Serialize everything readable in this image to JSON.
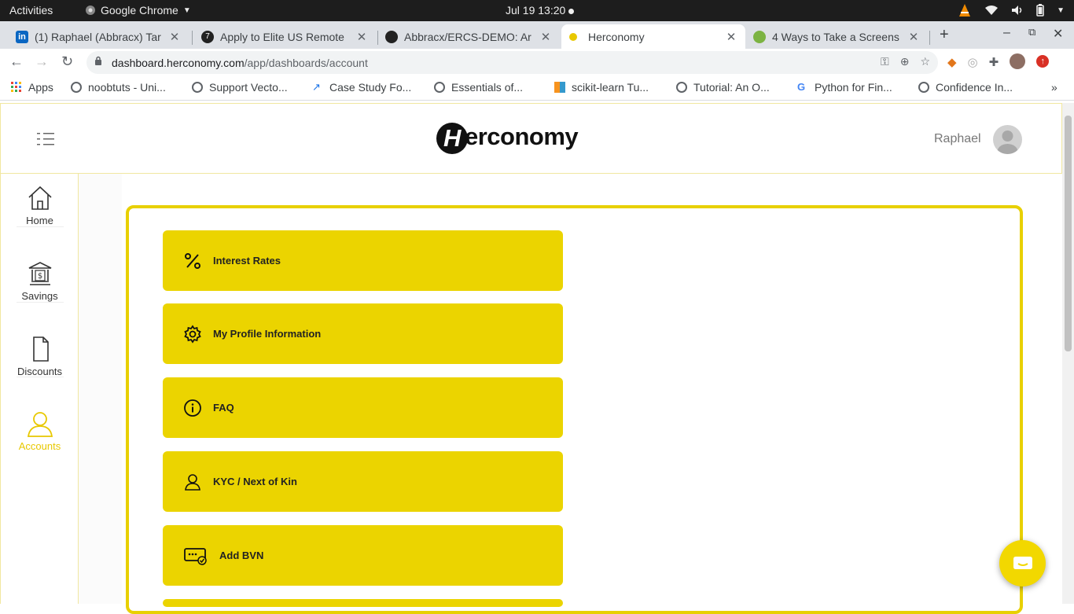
{
  "system_bar": {
    "activities": "Activities",
    "app_name": "Google Chrome",
    "clock": "Jul 19  13:20"
  },
  "tabs": [
    {
      "title": "(1) Raphael (Abbracx) Tar",
      "icon": "linkedin-icon",
      "color": "#0a66c2"
    },
    {
      "title": "Apply to Elite US Remote",
      "icon": "turing-icon",
      "color": "#222222"
    },
    {
      "title": "Abbracx/ERCS-DEMO: Ar",
      "icon": "github-icon",
      "color": "#222222"
    },
    {
      "title": "Herconomy",
      "icon": "herconomy-icon",
      "color": "#e8c800"
    },
    {
      "title": "4 Ways to Take a Screens",
      "icon": "wikihow-icon",
      "color": "#7cb342"
    }
  ],
  "address_bar": {
    "domain": "dashboard.herconomy.com",
    "path": "/app/dashboards/account"
  },
  "bookmarks": [
    {
      "label": "Apps",
      "icon": "apps-grid-icon"
    },
    {
      "label": "noobtuts - Uni...",
      "icon": "globe-icon"
    },
    {
      "label": "Support Vecto...",
      "icon": "globe-icon"
    },
    {
      "label": "Case Study Fo...",
      "icon": "chart-icon"
    },
    {
      "label": "Essentials of...",
      "icon": "globe-icon"
    },
    {
      "label": "scikit-learn Tu...",
      "icon": "bar-icon"
    },
    {
      "label": "Tutorial: An O...",
      "icon": "globe-icon"
    },
    {
      "label": "Python for Fin...",
      "icon": "google-icon"
    },
    {
      "label": "Confidence In...",
      "icon": "globe-icon"
    }
  ],
  "header": {
    "logo_text": "erconomy",
    "logo_mark": "H",
    "username": "Raphael"
  },
  "sidebar": {
    "items": [
      {
        "label": "Home",
        "icon": "home-icon"
      },
      {
        "label": "Savings",
        "icon": "bank-icon"
      },
      {
        "label": "Discounts",
        "icon": "document-icon"
      },
      {
        "label": "Accounts",
        "icon": "user-icon",
        "active": true
      }
    ]
  },
  "account_menu": {
    "items": [
      {
        "label": "Interest Rates",
        "icon": "percent-icon"
      },
      {
        "label": "My Profile Information",
        "icon": "gear-icon"
      },
      {
        "label": "FAQ",
        "icon": "info-icon"
      },
      {
        "label": "KYC / Next of Kin",
        "icon": "person-icon"
      },
      {
        "label": "Add BVN",
        "icon": "id-card-icon"
      }
    ]
  },
  "colors": {
    "accent": "#ebd400",
    "accent_border": "#e8d000",
    "active_nav": "#e8c800"
  }
}
